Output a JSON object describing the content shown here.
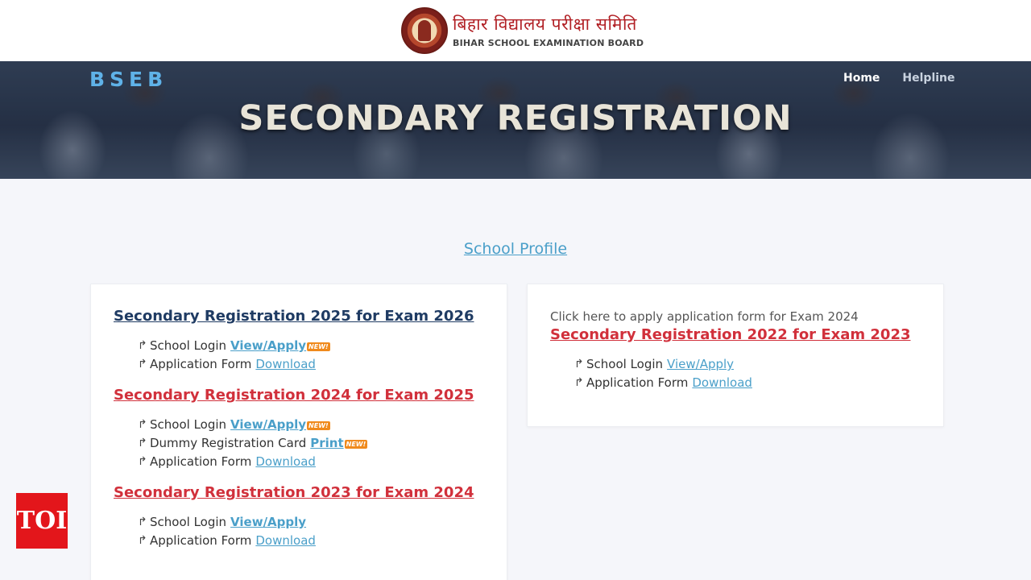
{
  "header": {
    "logo_hindi": "बिहार विद्यालय परीक्षा समिति",
    "logo_english": "BIHAR SCHOOL EXAMINATION BOARD"
  },
  "banner": {
    "brand": "BSEB",
    "title": "SECONDARY REGISTRATION",
    "nav": {
      "home": "Home",
      "helpline": "Helpline"
    }
  },
  "main": {
    "profile_link": "School Profile",
    "left_card": {
      "sections": [
        {
          "title": "Secondary Registration 2025 for Exam 2026",
          "items": [
            {
              "label": "School Login",
              "link": "View/Apply",
              "badge": "NEW!"
            },
            {
              "label": "Application Form",
              "link": "Download"
            }
          ]
        },
        {
          "title": "Secondary Registration 2024 for Exam 2025",
          "items": [
            {
              "label": "School Login",
              "link": "View/Apply",
              "badge": "NEW!"
            },
            {
              "label": "Dummy Registration Card",
              "link": "Print",
              "badge": "NEW!"
            },
            {
              "label": "Application Form",
              "link": "Download"
            }
          ]
        },
        {
          "title": "Secondary Registration 2023 for Exam 2024",
          "items": [
            {
              "label": "School Login",
              "link": "View/Apply"
            },
            {
              "label": "Application Form",
              "link": "Download"
            }
          ]
        }
      ]
    },
    "right_card": {
      "note": "Click here to apply application form for Exam 2024",
      "title": "Secondary Registration 2022 for Exam 2023",
      "items": [
        {
          "label": "School Login",
          "link": "View/Apply"
        },
        {
          "label": "Application Form",
          "link": "Download"
        }
      ]
    }
  },
  "watermark": {
    "toi": "TOI"
  },
  "colors": {
    "navy_title": "#1f3b63",
    "red_title": "#d1303b",
    "link": "#4a9fc9",
    "brand_blue": "#5fb2e8",
    "toi_red": "#e3161b"
  }
}
